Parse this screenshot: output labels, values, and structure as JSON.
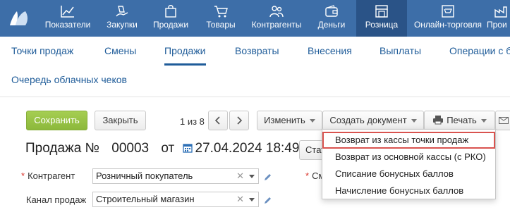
{
  "topnav": {
    "items": [
      {
        "label": "Показатели",
        "icon": "chart-icon"
      },
      {
        "label": "Закупки",
        "icon": "bag-hand-icon"
      },
      {
        "label": "Продажи",
        "icon": "shopping-bag-icon"
      },
      {
        "label": "Товары",
        "icon": "cart-icon"
      },
      {
        "label": "Контрагенты",
        "icon": "people-icon"
      },
      {
        "label": "Деньги",
        "icon": "wallet-icon"
      },
      {
        "label": "Розница",
        "icon": "store-icon"
      },
      {
        "label": "Онлайн-торговля",
        "icon": "online-store-icon"
      },
      {
        "label": "Прои",
        "icon": "production-icon"
      }
    ],
    "active": "Розница"
  },
  "subtabs": {
    "items": [
      "Точки продаж",
      "Смены",
      "Продажи",
      "Возвраты",
      "Внесения",
      "Выплаты",
      "Операции с б",
      "Очередь облачных чеков"
    ],
    "active": "Продажи"
  },
  "toolbar": {
    "save_label": "Сохранить",
    "close_label": "Закрыть",
    "pager_text": "1 из 8",
    "edit_label": "Изменить",
    "create_doc_label": "Создать документ",
    "print_label": "Печать",
    "status_label": "Стат"
  },
  "doc": {
    "title": "Продажа №",
    "number": "00003",
    "from": "от",
    "datetime": "27.04.2024 18:49"
  },
  "form": {
    "counterparty_label": "Контрагент",
    "counterparty_value": "Розничный покупатель",
    "channel_label": "Канал продаж",
    "channel_value": "Строительный магазин",
    "shift_label": "См"
  },
  "menu": {
    "items": [
      "Возврат из кассы точки продаж",
      "Возврат из основной кассы (с РКО)",
      "Списание бонусных баллов",
      "Начисление бонусных баллов"
    ],
    "highlighted_index": 0
  },
  "colors": {
    "nav_bg": "#3d6ea8",
    "nav_active": "#2a5387",
    "link": "#1f5c99",
    "save_green": "#8cb83b",
    "required": "#d9342b",
    "highlight": "#d9534f"
  }
}
